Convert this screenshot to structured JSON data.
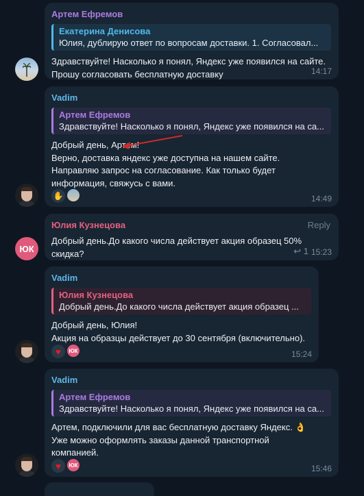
{
  "messages": [
    {
      "sender": "Артем Ефремов",
      "sender_color": "#a97be0",
      "quote": {
        "name": "Екатерина Денисова",
        "text": "Юлия, дублирую ответ по вопросам доставки.  1. Согласовал...",
        "color": "#4fb8e8"
      },
      "text": "Здравствуйте! Насколько я понял, Яндекс уже появился на сайте. Прошу согласовать бесплатную доставку",
      "time": "14:17"
    },
    {
      "sender": "Vadim",
      "sender_color": "#5db7e8",
      "quote": {
        "name": "Артем Ефремов",
        "text": "Здравствуйте! Насколько я понял, Яндекс уже появился на са...",
        "color": "#a97be0"
      },
      "text_lines": [
        "Добрый день, Артем!",
        "Верно, доставка яндекс уже доступна на нашем сайте.",
        "Направляю запрос на согласование. Как только будет",
        "информация, свяжусь с вами."
      ],
      "reactions": [
        "handshake-emoji",
        "palm-avatar"
      ],
      "time": "14:49"
    },
    {
      "sender": "Юлия Кузнецова",
      "sender_color": "#e5607f",
      "reply_label": "Reply",
      "text": "Добрый день.До какого числа действует акция образец 50% скидка?",
      "time": "15:23",
      "avatar_initials": "ЮК"
    },
    {
      "sender": "Vadim",
      "sender_color": "#5db7e8",
      "quote": {
        "name": "Юлия Кузнецова",
        "text": "Добрый день.До какого числа действует акция образец ...",
        "color": "#e5607f"
      },
      "text_lines": [
        "Добрый день, Юлия!",
        "Акция на образцы действует до 30 сентября (включительно)."
      ],
      "reactions": [
        "heart",
        "ЮК"
      ],
      "time": "15:24"
    },
    {
      "sender": "Vadim",
      "sender_color": "#5db7e8",
      "quote": {
        "name": "Артем Ефремов",
        "text": "Здравствуйте! Насколько я понял, Яндекс уже появился на са...",
        "color": "#a97be0"
      },
      "text_lines": [
        "Артем, подключили для вас бесплатную доставку Яндекс. 👌",
        "Уже можно оформлять заказы данной транспортной",
        "компанией."
      ],
      "reactions": [
        "heart",
        "ЮК"
      ],
      "time": "15:46"
    }
  ]
}
